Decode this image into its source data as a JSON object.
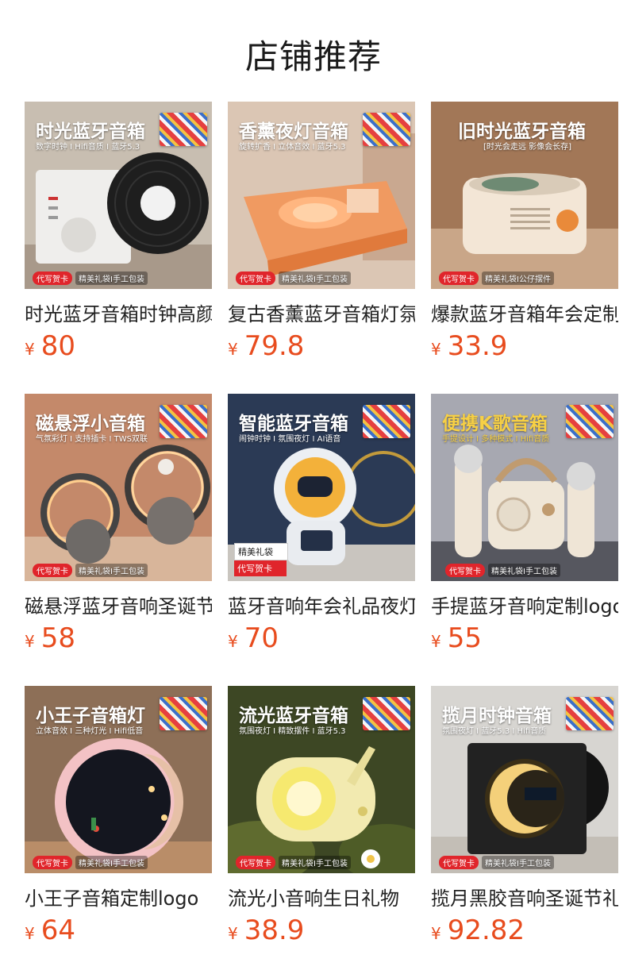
{
  "page": {
    "title": "店铺推荐"
  },
  "products": [
    {
      "name": "时光蓝牙音箱时钟高颜值",
      "currency": "¥",
      "price": "80",
      "image": {
        "headline": "时光蓝牙音箱",
        "subline": "数字时钟 I Hifi音质 I 蓝牙5.3",
        "tag_red": "代写贺卡",
        "tag_text": "精美礼袋I手工包装",
        "bg": "#c9bfb2"
      }
    },
    {
      "name": "复古香薰蓝牙音箱灯氛围",
      "currency": "¥",
      "price": "79.8",
      "image": {
        "headline": "香薰夜灯音箱",
        "subline": "旋转扩香 I 立体音效 I 蓝牙5.3",
        "tag_red": "代写贺卡",
        "tag_text": "精美礼袋I手工包装",
        "bg": "#d9c3b0"
      }
    },
    {
      "name": "爆款蓝牙音箱年会定制",
      "currency": "¥",
      "price": "33.9",
      "image": {
        "headline": "旧时光蓝牙音箱",
        "subline": "[时光会走远 影像会长存]",
        "tag_red": "代写贺卡",
        "tag_text": "精美礼袋I公仔摆件",
        "bg": "#a77a5a"
      }
    },
    {
      "name": "磁悬浮蓝牙音响圣诞节",
      "currency": "¥",
      "price": "58",
      "image": {
        "headline": "磁悬浮小音箱",
        "subline": "气氛彩灯 I 支持插卡 I TWS双联",
        "tag_red": "代写贺卡",
        "tag_text": "精美礼袋I手工包装",
        "bg": "#c48a6a"
      }
    },
    {
      "name": "蓝牙音响年会礼品夜灯",
      "currency": "¥",
      "price": "70",
      "image": {
        "headline": "智能蓝牙音箱",
        "subline": "闹钟时钟 I 氛围夜灯 I AI语音",
        "tag_red": "代写贺卡",
        "tag_text": "精美礼袋",
        "bg": "#2c3c57"
      }
    },
    {
      "name": "手提蓝牙音响定制logo",
      "currency": "¥",
      "price": "55",
      "image": {
        "headline": "便携K歌音箱",
        "subline": "手提设计 I 多种模式 I Hifi音质",
        "tag_red": "代写贺卡",
        "tag_text": "精美礼袋I手工包装",
        "bg": "#a9aab2"
      }
    },
    {
      "name": "小王子音箱定制logo",
      "currency": "¥",
      "price": "64",
      "image": {
        "headline": "小王子音箱灯",
        "subline": "立体音效 I 三种灯光 I Hifi低音",
        "tag_red": "代写贺卡",
        "tag_text": "精美礼袋I手工包装",
        "bg": "#8e7058"
      }
    },
    {
      "name": "流光小音响生日礼物",
      "currency": "¥",
      "price": "38.9",
      "image": {
        "headline": "流光蓝牙音箱",
        "subline": "氛围夜灯 I 精致摆件 I 蓝牙5.3",
        "tag_red": "代写贺卡",
        "tag_text": "精美礼袋I手工包装",
        "bg": "#3f4a23"
      }
    },
    {
      "name": "揽月黑胶音响圣诞节礼物",
      "currency": "¥",
      "price": "92.82",
      "image": {
        "headline": "揽月时钟音箱",
        "subline": "氛围夜灯 I 蓝牙5.3 I Hifi音质",
        "tag_red": "代写贺卡",
        "tag_text": "精美礼袋I手工包装",
        "bg": "#d6d4d0"
      }
    }
  ]
}
